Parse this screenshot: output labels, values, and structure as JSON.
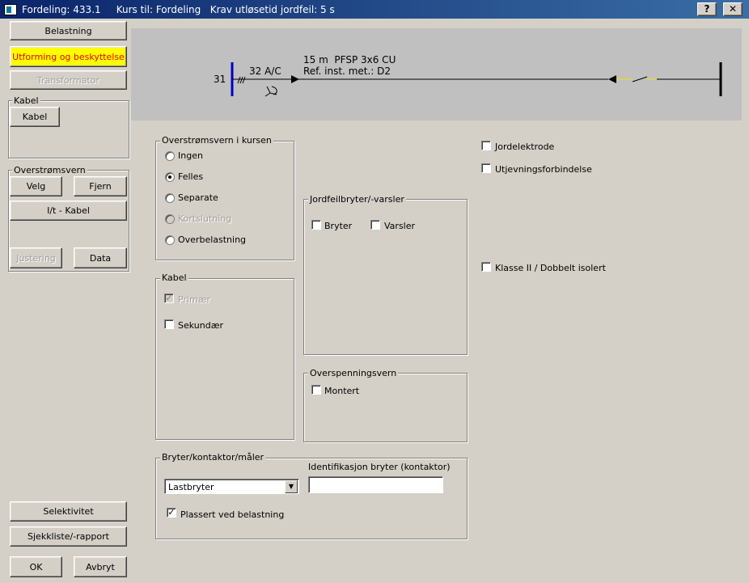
{
  "window": {
    "title": "Fordeling: 433.1     Kurs til: Fordeling   Krav utløsetid jordfeil: 5 s",
    "help_label": "?",
    "close_label": "✕"
  },
  "left_panel": {
    "belastning": "Belastning",
    "utforming": "Utforming og beskyttelse",
    "transformator": "Transformator",
    "kabel_group": {
      "title": "Kabel",
      "kabel_button": "Kabel"
    },
    "vern_group": {
      "title": "Overstrømsvern",
      "velg": "Velg",
      "fjern": "Fjern",
      "it_kabel": "I/t - Kabel",
      "justering": "Justering",
      "data": "Data"
    },
    "selektivitet": "Selektivitet",
    "sjekkliste": "Sjekkliste/-rapport",
    "ok": "OK",
    "avbryt": "Avbryt"
  },
  "diagram": {
    "node_number": "31",
    "fuse_rating": "32 A/C",
    "cable_line1": "15 m  PFSP 3x6 CU",
    "cable_line2": "Ref. inst. met.: D2"
  },
  "vern_kurs": {
    "title": "Overstrømsvern i kursen",
    "options": [
      {
        "label": "Ingen",
        "checked": false,
        "disabled": false
      },
      {
        "label": "Felles",
        "checked": true,
        "disabled": false
      },
      {
        "label": "Separate",
        "checked": false,
        "disabled": false
      },
      {
        "label": "Kortslutning",
        "checked": false,
        "disabled": true
      },
      {
        "label": "Overbelastning",
        "checked": false,
        "disabled": false
      }
    ]
  },
  "kabel_section": {
    "title": "Kabel",
    "primaer": "Primær",
    "primaer_checked": true,
    "sekundaer": "Sekundær",
    "sekundaer_checked": false
  },
  "jordfeil": {
    "title": "Jordfeilbryter/-varsler",
    "bryter": "Bryter",
    "varsler": "Varsler"
  },
  "overspenning": {
    "title": "Overspenningsvern",
    "montert": "Montert"
  },
  "right_options": {
    "jordelektrode": "Jordelektrode",
    "utjevning": "Utjevningsforbindelse",
    "klasse2": "Klasse II / Dobbelt isolert"
  },
  "bryter_section": {
    "title": "Bryter/kontaktor/måler",
    "select_value": "Lastbryter",
    "ident_label": "Identifikasjon bryter (kontaktor)",
    "ident_value": "",
    "plassert": "Plassert ved belastning",
    "plassert_checked": true
  },
  "colors": {
    "title_start": "#0a246a",
    "title_end": "#3a6ea5",
    "highlight_bg": "#ffff00",
    "highlight_text": "#e00000",
    "busbar": "#0000cc",
    "switch_yellow": "#e8e800"
  }
}
